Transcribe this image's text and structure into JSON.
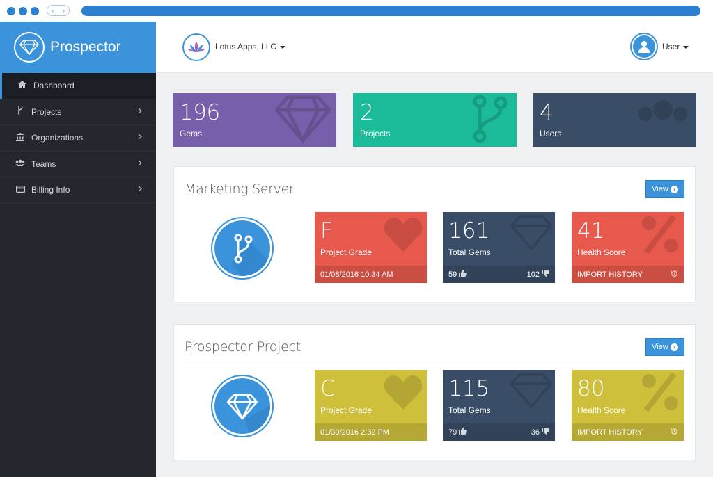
{
  "app": {
    "name": "Prospector"
  },
  "browser": {
    "back_glyph": "‹",
    "forward_glyph": "›"
  },
  "colors": {
    "accent": "#3b93db",
    "sidebar": "#23282f",
    "purple": "#785fab",
    "teal": "#1bba98",
    "slate": "#3a4d66",
    "red": "#e8594d",
    "yellow": "#cfc03c"
  },
  "sidebar": {
    "items": [
      {
        "label": "Dashboard",
        "icon": "home-icon"
      },
      {
        "label": "Projects",
        "icon": "branch-icon"
      },
      {
        "label": "Organizations",
        "icon": "bank-icon"
      },
      {
        "label": "Teams",
        "icon": "users-icon"
      },
      {
        "label": "Billing Info",
        "icon": "credit-card-icon"
      }
    ]
  },
  "topbar": {
    "org_name": "Lotus Apps, LLC",
    "user_name": "User"
  },
  "stats": [
    {
      "value": "196",
      "label": "Gems",
      "icon": "gem-icon"
    },
    {
      "value": "2",
      "label": "Projects",
      "icon": "branch-icon"
    },
    {
      "value": "4",
      "label": "Users",
      "icon": "users-icon"
    }
  ],
  "projects": [
    {
      "title": "Marketing Server",
      "icon": "branch-icon",
      "view_label": "View",
      "grade": {
        "value": "F",
        "label": "Project Grade",
        "footer": "01/08/2016 10:34 AM"
      },
      "gems": {
        "value": "161",
        "label": "Total Gems",
        "up": "59",
        "down": "102"
      },
      "health": {
        "value": "41",
        "label": "Health Score",
        "footer": "IMPORT HISTORY"
      }
    },
    {
      "title": "Prospector Project",
      "icon": "gem-icon",
      "view_label": "View",
      "grade": {
        "value": "C",
        "label": "Project Grade",
        "footer": "01/30/2016 2:32 PM"
      },
      "gems": {
        "value": "115",
        "label": "Total Gems",
        "up": "79",
        "down": "36"
      },
      "health": {
        "value": "80",
        "label": "Health Score",
        "footer": "IMPORT HISTORY"
      }
    }
  ]
}
